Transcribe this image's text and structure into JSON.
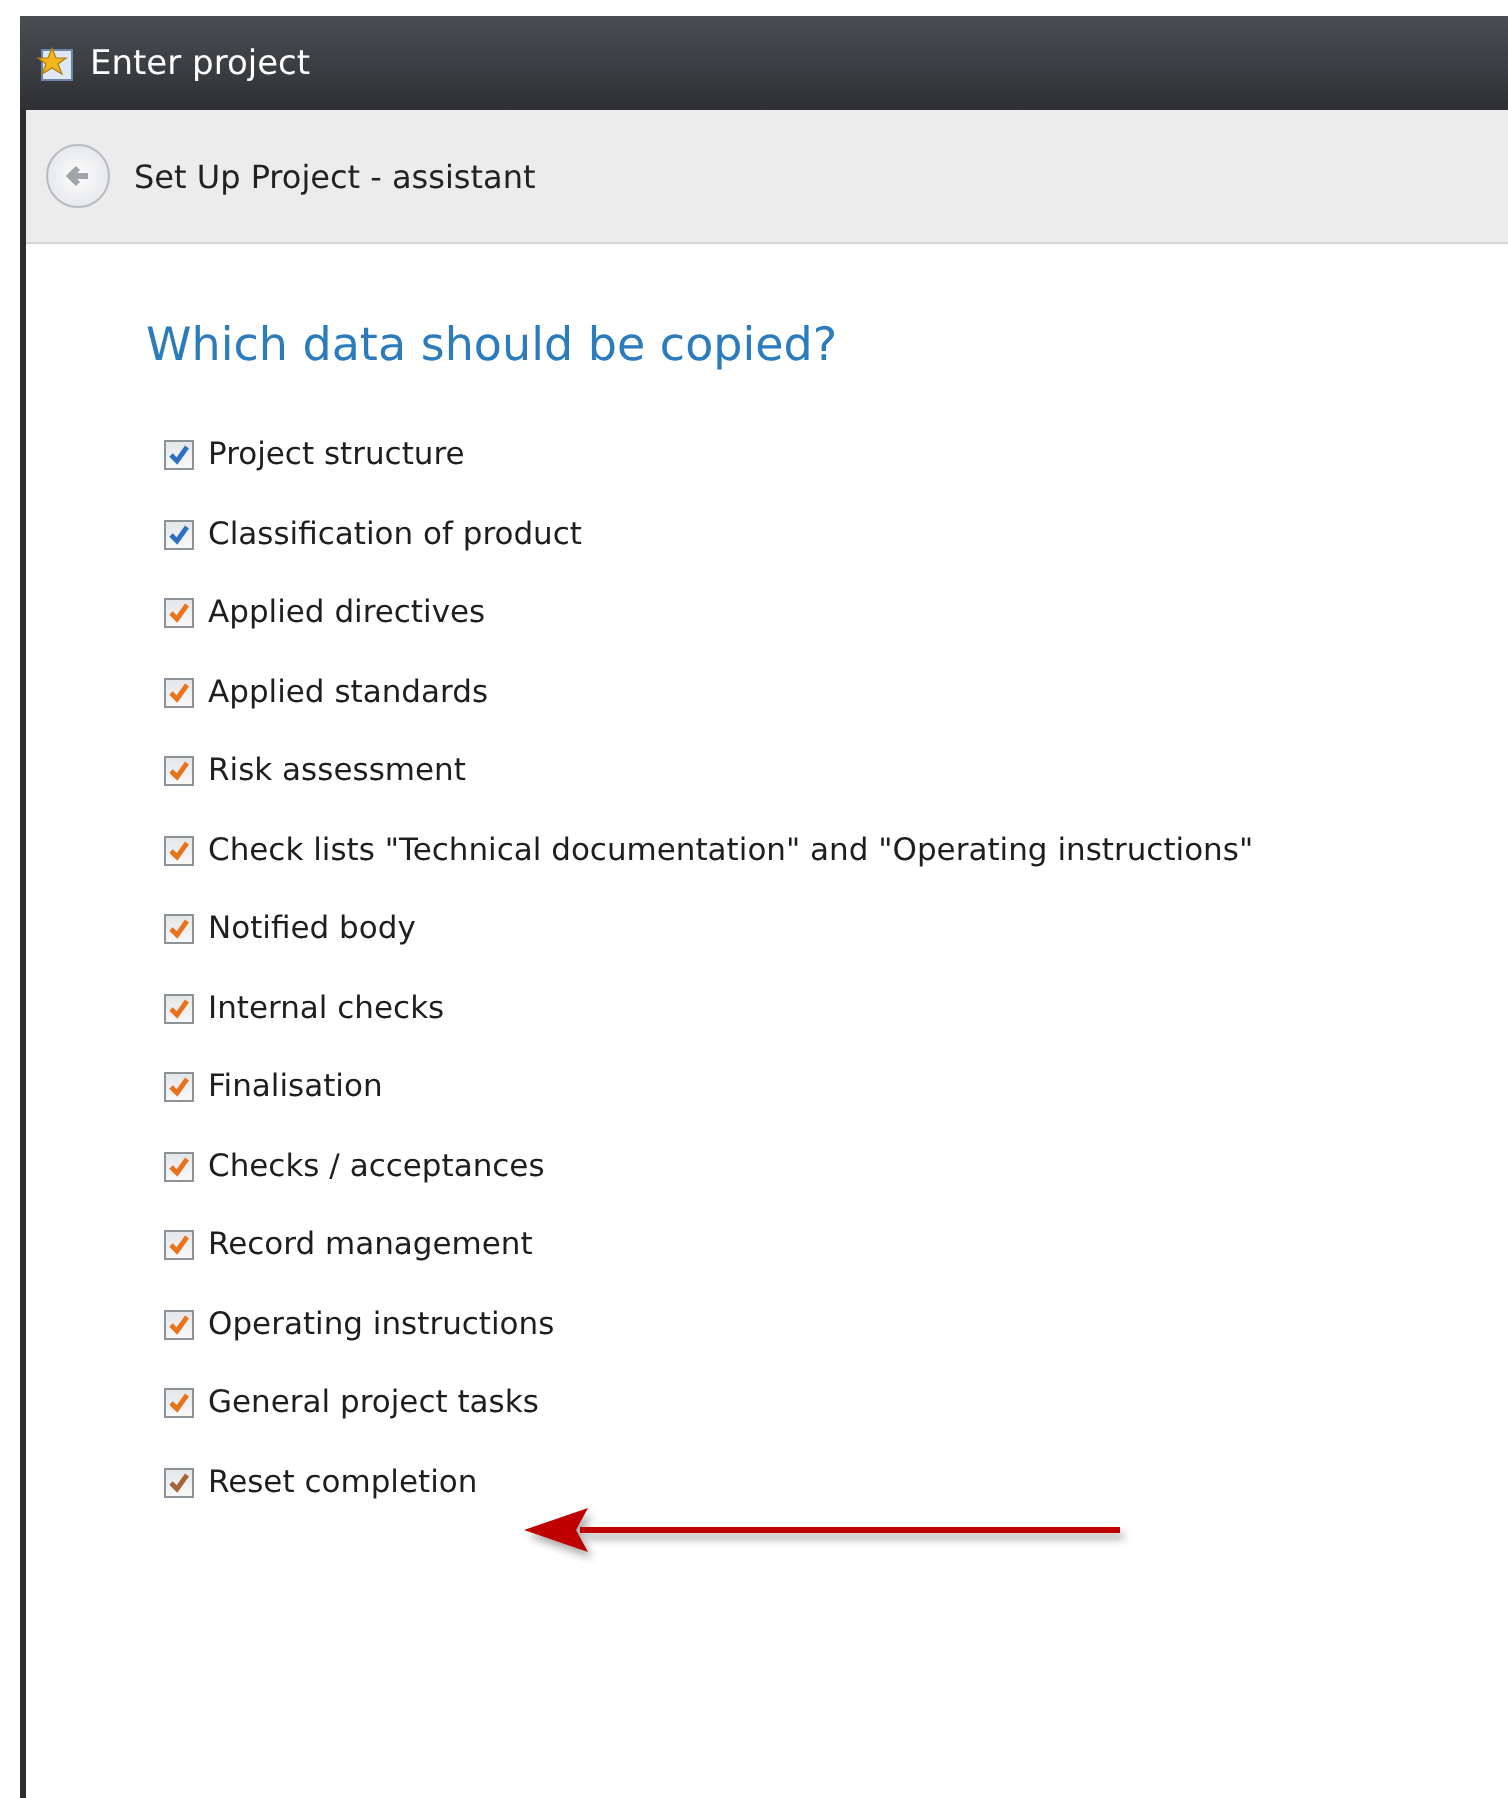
{
  "window": {
    "title": "Enter project"
  },
  "header": {
    "title": "Set Up Project - assistant"
  },
  "heading": "Which data should be copied?",
  "options": [
    {
      "label": "Project structure",
      "checked": true,
      "color": "#2f6fc0"
    },
    {
      "label": "Classification of product",
      "checked": true,
      "color": "#2f6fc0"
    },
    {
      "label": "Applied directives",
      "checked": true,
      "color": "#e8731c"
    },
    {
      "label": "Applied standards",
      "checked": true,
      "color": "#e8731c"
    },
    {
      "label": "Risk assessment",
      "checked": true,
      "color": "#e8731c"
    },
    {
      "label": "Check lists \"Technical documentation\" and \"Operating instructions\"",
      "checked": true,
      "color": "#e8731c"
    },
    {
      "label": "Notified body",
      "checked": true,
      "color": "#e8731c"
    },
    {
      "label": "Internal checks",
      "checked": true,
      "color": "#e8731c"
    },
    {
      "label": "Finalisation",
      "checked": true,
      "color": "#e8731c"
    },
    {
      "label": "Checks / acceptances",
      "checked": true,
      "color": "#e8731c"
    },
    {
      "label": "Record management",
      "checked": true,
      "color": "#e8731c"
    },
    {
      "label": "Operating instructions",
      "checked": true,
      "color": "#e8731c"
    },
    {
      "label": "General project tasks",
      "checked": true,
      "color": "#e8731c"
    },
    {
      "label": "Reset completion",
      "checked": true,
      "color": "#a8623a"
    }
  ]
}
